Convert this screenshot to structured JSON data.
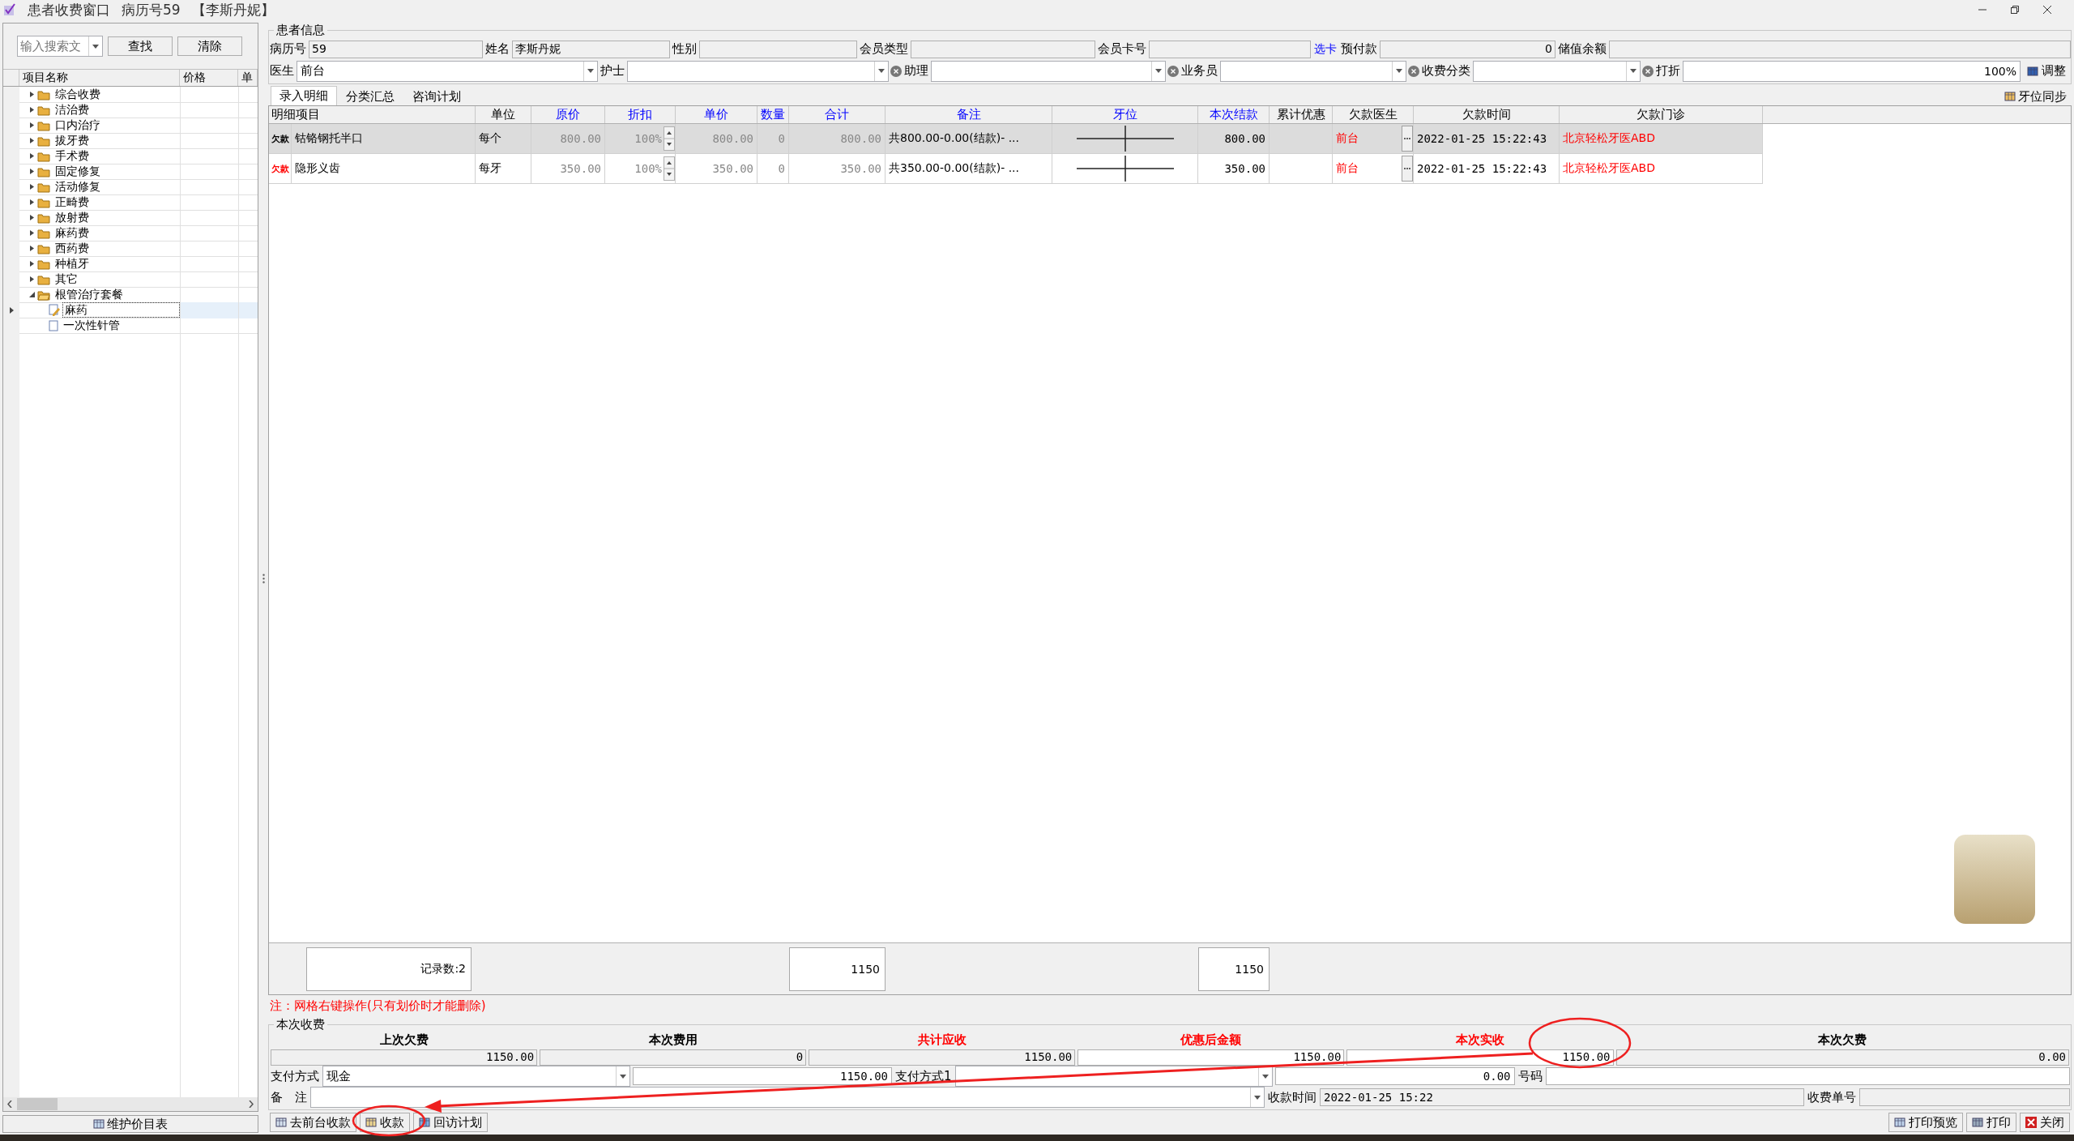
{
  "window": {
    "title": "患者收费窗口",
    "record_no": "病历号59",
    "patient": "【李斯丹妮】"
  },
  "sidebar": {
    "search": {
      "placeholder": "输入搜索文"
    },
    "buttons": [
      "查找",
      "清除"
    ],
    "columns": [
      "项目名称",
      "价格",
      "单"
    ],
    "tree": [
      {
        "label": "综合收费",
        "expanded": false,
        "selected": false
      },
      {
        "label": "洁治费",
        "expanded": false,
        "selected": false
      },
      {
        "label": "口内治疗",
        "expanded": false,
        "selected": false
      },
      {
        "label": "拔牙费",
        "expanded": false,
        "selected": false
      },
      {
        "label": "手术费",
        "expanded": false,
        "selected": false
      },
      {
        "label": "固定修复",
        "expanded": false,
        "selected": false
      },
      {
        "label": "活动修复",
        "expanded": false,
        "selected": false
      },
      {
        "label": "正畸费",
        "expanded": false,
        "selected": false
      },
      {
        "label": "放射费",
        "expanded": false,
        "selected": false
      },
      {
        "label": "麻药费",
        "expanded": false,
        "selected": false
      },
      {
        "label": "西药费",
        "expanded": false,
        "selected": false
      },
      {
        "label": "种植牙",
        "expanded": false,
        "selected": false
      },
      {
        "label": "其它",
        "expanded": false,
        "selected": false
      },
      {
        "label": "根管治疗套餐",
        "expanded": true,
        "selected": false,
        "children": [
          {
            "label": "麻药",
            "selected": true,
            "kind": "editing"
          },
          {
            "label": "一次性针管",
            "selected": false,
            "kind": "item"
          }
        ]
      }
    ],
    "maintain_button": "维护价目表"
  },
  "patient_info": {
    "title": "患者信息",
    "fields": [
      {
        "label": "病历号",
        "value": "59",
        "kind": "text"
      },
      {
        "label": "姓名",
        "value": "李斯丹妮",
        "kind": "text"
      },
      {
        "label": "性别",
        "kind": "text"
      },
      {
        "label": "会员类型",
        "kind": "text"
      },
      {
        "label": "会员卡号",
        "kind": "card",
        "link": "选卡"
      },
      {
        "label": "预付款",
        "value": "0",
        "kind": "number"
      },
      {
        "label": "储值余额",
        "kind": "text"
      }
    ],
    "selectors": [
      {
        "label": "医生",
        "value": "前台",
        "clearable": false
      },
      {
        "label": "护士",
        "clearable": true
      },
      {
        "label": "助理",
        "clearable": true
      },
      {
        "label": "业务员",
        "clearable": true
      },
      {
        "label": "收费分类",
        "clearable": true
      }
    ],
    "discount": {
      "label": "打折",
      "value": "100%"
    },
    "adjust_button": "调整"
  },
  "tabs": [
    {
      "label": "录入明细",
      "selected": true
    },
    {
      "label": "分类汇总",
      "selected": false
    },
    {
      "label": "咨询计划",
      "selected": false
    }
  ],
  "sync_button": "牙位同步",
  "table": {
    "columns": [
      {
        "label": "明细项目",
        "color": "#000000"
      },
      {
        "label": "单位",
        "color": "#000000"
      },
      {
        "label": "原价",
        "color": "#0000ff"
      },
      {
        "label": "折扣",
        "color": "#0000ff"
      },
      {
        "label": "单价",
        "color": "#0000ff"
      },
      {
        "label": "数量",
        "color": "#0000ff"
      },
      {
        "label": "合计",
        "color": "#0000ff"
      },
      {
        "label": "备注",
        "color": "#0000ff"
      },
      {
        "label": "牙位",
        "color": "#0000ff"
      },
      {
        "label": "本次结款",
        "color": "#0000ff"
      },
      {
        "label": "累计优惠",
        "color": "#000000"
      },
      {
        "label": "欠款医生",
        "color": "#000000"
      },
      {
        "label": "欠款时间",
        "color": "#000000"
      },
      {
        "label": "欠款门诊",
        "color": "#000000"
      }
    ],
    "rows": [
      {
        "tag": "欠款",
        "selected": true,
        "item": "钴铬钢托半口",
        "unit": "每个",
        "original_price": "800.00",
        "discount": "100%",
        "price": "800.00",
        "quantity": "0",
        "total": "800.00",
        "remark": "共800.00-0.00(结款)- ...",
        "settlement": "800.00",
        "doctor": "前台",
        "time": "2022-01-25 15:22:43",
        "clinic": "北京轻松牙医ABD"
      },
      {
        "tag": "欠款",
        "selected": false,
        "item": "隐形义齿",
        "unit": "每牙",
        "original_price": "350.00",
        "discount": "100%",
        "price": "350.00",
        "quantity": "0",
        "total": "350.00",
        "remark": "共350.00-0.00(结款)- ...",
        "settlement": "350.00",
        "doctor": "前台",
        "time": "2022-01-25 15:22:43",
        "clinic": "北京轻松牙医ABD"
      }
    ],
    "footer": {
      "record_count": "记录数:2",
      "total": "1150",
      "settlement": "1150"
    }
  },
  "note": "注：网格右键操作(只有划价时才能删除)",
  "charge": {
    "title": "本次收费",
    "summary": [
      {
        "label": "上次欠费",
        "value": "1150.00",
        "color": "#000000",
        "editable": false
      },
      {
        "label": "本次费用",
        "value": "0",
        "color": "#000000",
        "editable": false
      },
      {
        "label": "共计应收",
        "value": "1150.00",
        "color": "#ff0000",
        "editable": false
      },
      {
        "label": "优惠后金额",
        "value": "1150.00",
        "color": "#ff0000",
        "editable": true
      },
      {
        "label": "本次实收",
        "value": "1150.00",
        "color": "#ff0000",
        "editable": true
      },
      {
        "label": "本次欠费",
        "value": "0.00",
        "color": "#000000",
        "editable": false
      }
    ],
    "payment": {
      "label": "支付方式",
      "value": "现金",
      "amount": "1150.00",
      "label2": "支付方式1",
      "amount2": "0.00",
      "number_label": "号码"
    },
    "remark": {
      "label": "备　注",
      "time_label": "收款时间",
      "time": "2022-01-25 15:22",
      "receipt_label": "收费单号"
    }
  },
  "left_buttons": [
    "去前台收款",
    "收款",
    "回访计划"
  ],
  "right_buttons": [
    {
      "label": "打印预览",
      "kind": "preview"
    },
    {
      "label": "打印",
      "kind": "print"
    },
    {
      "label": "关闭",
      "kind": "close"
    }
  ]
}
